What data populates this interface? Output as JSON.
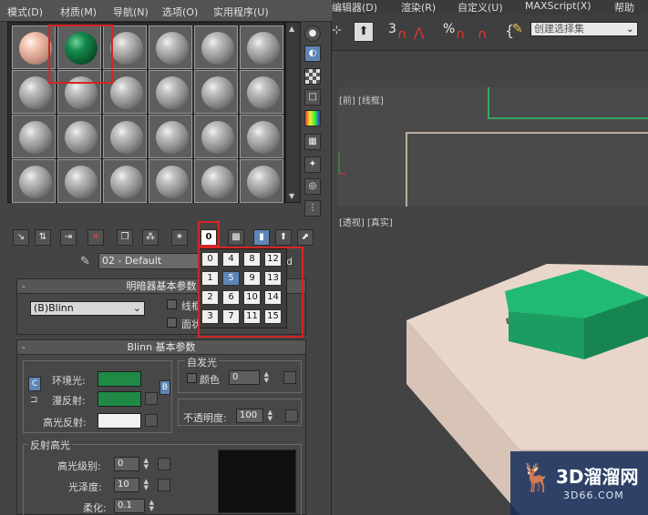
{
  "material_editor": {
    "menu": [
      "模式(D)",
      "材质(M)",
      "导航(N)",
      "选项(O)",
      "实用程序(U)"
    ],
    "material_name": "02 - Default",
    "name_suffix": "d",
    "shader_rollout": {
      "title": "明暗器基本参数",
      "shader": "(B)Blinn",
      "wire_label": "线框",
      "faceted_label": "面状"
    },
    "blinn_rollout": {
      "title": "Blinn 基本参数",
      "ambient_label": "环境光:",
      "diffuse_label": "漫反射:",
      "specular_label": "高光反射:",
      "ambient_color": "#1f8a46",
      "diffuse_color": "#1f8a46",
      "specular_color": "#f2f2f2",
      "self_illum_title": "自发光",
      "color_label": "颜色",
      "self_illum_value": "0",
      "opacity_label": "不透明度:",
      "opacity_value": "100",
      "lock_C": "C",
      "lock_B": "B"
    },
    "specular_highlights": {
      "title": "反射高光",
      "level_label": "高光级别:",
      "level_value": "0",
      "gloss_label": "光泽度:",
      "gloss_value": "10",
      "soften_label": "柔化:",
      "soften_value": "0.1"
    },
    "sample_count_button": "0",
    "sample_count_popup": [
      "0",
      "4",
      "8",
      "12",
      "1",
      "5",
      "9",
      "13",
      "2",
      "6",
      "10",
      "14",
      "3",
      "7",
      "11",
      "15"
    ],
    "sample_count_selected": "5"
  },
  "main_window": {
    "menu": [
      "编辑器(D)",
      "渲染(R)",
      "自定义(U)",
      "MAXScript(X)",
      "帮助"
    ],
    "snap_labels": [
      "3",
      "%"
    ],
    "selection_set_placeholder": "创建选择集",
    "top_viewport_label": "[前] [线框]",
    "persp_viewport_label": "[透视] [真实]"
  },
  "watermark": {
    "main": "3D溜溜网",
    "sub": "3D66.COM"
  },
  "colors": {
    "box_green": "#1e9a64",
    "plane": "#e9d8cd",
    "highlight_red": "#d42525"
  }
}
